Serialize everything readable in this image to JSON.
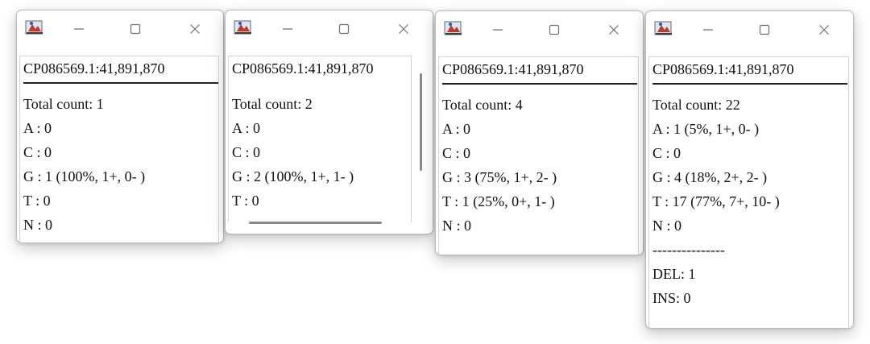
{
  "windows": [
    {
      "position": "CP086569.1:41,891,870",
      "total_count": "Total count: 1",
      "A": "A : 0",
      "C": "C : 0",
      "G": "G : 1 (100%, 1+, 0- )",
      "T": "T : 0",
      "N": "N : 0"
    },
    {
      "position": "CP086569.1:41,891,870",
      "total_count": "Total count: 2",
      "A": "A : 0",
      "C": "C : 0",
      "G": "G : 2 (100%, 1+, 1- )",
      "T": "T : 0"
    },
    {
      "position": "CP086569.1:41,891,870",
      "total_count": "Total count: 4",
      "A": "A : 0",
      "C": "C : 0",
      "G": "G : 3 (75%, 1+, 2- )",
      "T": "T : 1 (25%, 0+, 1- )",
      "N": "N : 0"
    },
    {
      "position": "CP086569.1:41,891,870",
      "total_count": "Total count: 22",
      "A": "A : 1 (5%, 1+, 0- )",
      "C": "C : 0",
      "G": "G : 4 (18%, 2+, 2- )",
      "T": "T : 17 (77%, 7+, 10- )",
      "N": "N : 0",
      "dashes": "---------------",
      "del": "DEL: 1",
      "ins": "INS: 0"
    }
  ],
  "icons": {
    "app": "java-app-icon",
    "minimize": "minimize-icon",
    "maximize": "maximize-icon",
    "close": "close-icon"
  },
  "colors": {
    "text": "#111111",
    "separator": "#222222",
    "control_glyph": "#6f6f6f"
  }
}
